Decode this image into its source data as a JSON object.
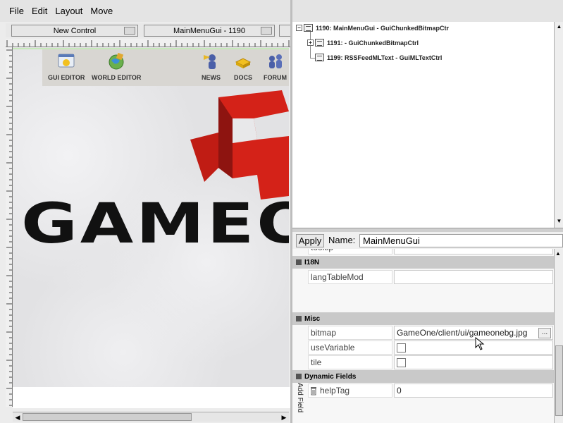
{
  "menu": [
    "File",
    "Edit",
    "Layout",
    "Move"
  ],
  "controls": {
    "new_control": "New Control",
    "current_gui": "MainMenuGui - 1190"
  },
  "canvas": {
    "toolbar": [
      {
        "label": "GUI EDITOR",
        "icon": "gui-editor-icon"
      },
      {
        "label": "WORLD EDITOR",
        "icon": "world-editor-icon"
      },
      {
        "label": "NEWS",
        "icon": "news-icon"
      },
      {
        "label": "DOCS",
        "icon": "docs-icon"
      },
      {
        "label": "FORUM",
        "icon": "forum-icon"
      }
    ],
    "title_text": "GAMEO"
  },
  "tree": [
    {
      "label": "1190: MainMenuGui - GuiChunkedBitmapCtr",
      "expander": "−"
    },
    {
      "label": "1191:  - GuiChunkedBitmapCtrl",
      "expander": "+"
    },
    {
      "label": "1199: RSSFeedMLText - GuiMLTextCtrl",
      "expander": ""
    }
  ],
  "namebar": {
    "apply": "Apply",
    "name_label": "Name:",
    "name_value": "MainMenuGui"
  },
  "inspector": {
    "partial_row": "tooltip",
    "sections": [
      {
        "title": "I18N",
        "fields": [
          {
            "label": "langTableMod",
            "value": ""
          }
        ]
      },
      {
        "title": "Misc",
        "fields": [
          {
            "label": "bitmap",
            "value": "GameOne/client/ui/gameonebg.jpg"
          },
          {
            "label": "useVariable",
            "checkbox": false
          },
          {
            "label": "tile",
            "checkbox": false
          }
        ]
      },
      {
        "title": "Dynamic Fields",
        "fields": [
          {
            "label": "helpTag",
            "value": "0"
          }
        ]
      }
    ],
    "browse_label": "...",
    "add_field": "Add Field"
  },
  "colors": {
    "logo_red": "#d42218",
    "canvas_border": "#aee0a0"
  }
}
